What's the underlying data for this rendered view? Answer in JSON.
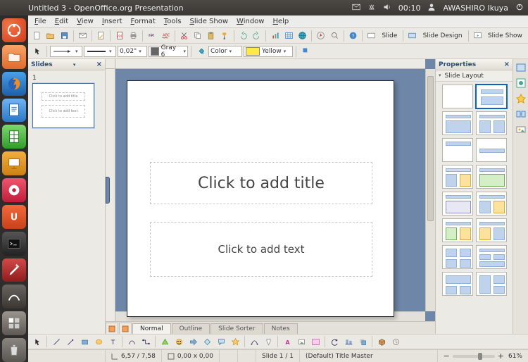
{
  "system": {
    "title": "Untitled 3 - OpenOffice.org Presentation",
    "time": "00:10",
    "user": "AWASHIRO Ikuya"
  },
  "menubar": [
    "File",
    "Edit",
    "View",
    "Insert",
    "Format",
    "Tools",
    "Slide Show",
    "Window",
    "Help"
  ],
  "toolbar1": {
    "slide_btn": "Slide",
    "slide_design_btn": "Slide Design",
    "slide_show_btn": "Slide Show"
  },
  "toolbar2": {
    "line_width": "0,02\"",
    "line_color_label": "Gray 6",
    "fill_label": "Color",
    "fill_color_label": "Yellow"
  },
  "slides_pane": {
    "title": "Slides",
    "thumb_number": "1",
    "thumb_title_ph": "Click to add title",
    "thumb_text_ph": "Click to add text"
  },
  "canvas": {
    "title_placeholder": "Click to add title",
    "text_placeholder": "Click to add text"
  },
  "view_tabs": {
    "normal": "Normal",
    "outline": "Outline",
    "sorter": "Slide Sorter",
    "notes": "Notes"
  },
  "task_pane": {
    "title": "Properties",
    "section": "Slide Layout"
  },
  "statusbar": {
    "pos": "6,57 / 7,58",
    "size": "0,00 x 0,00",
    "slide": "Slide 1 / 1",
    "master": "(Default) Title Master",
    "zoom": "61%"
  }
}
